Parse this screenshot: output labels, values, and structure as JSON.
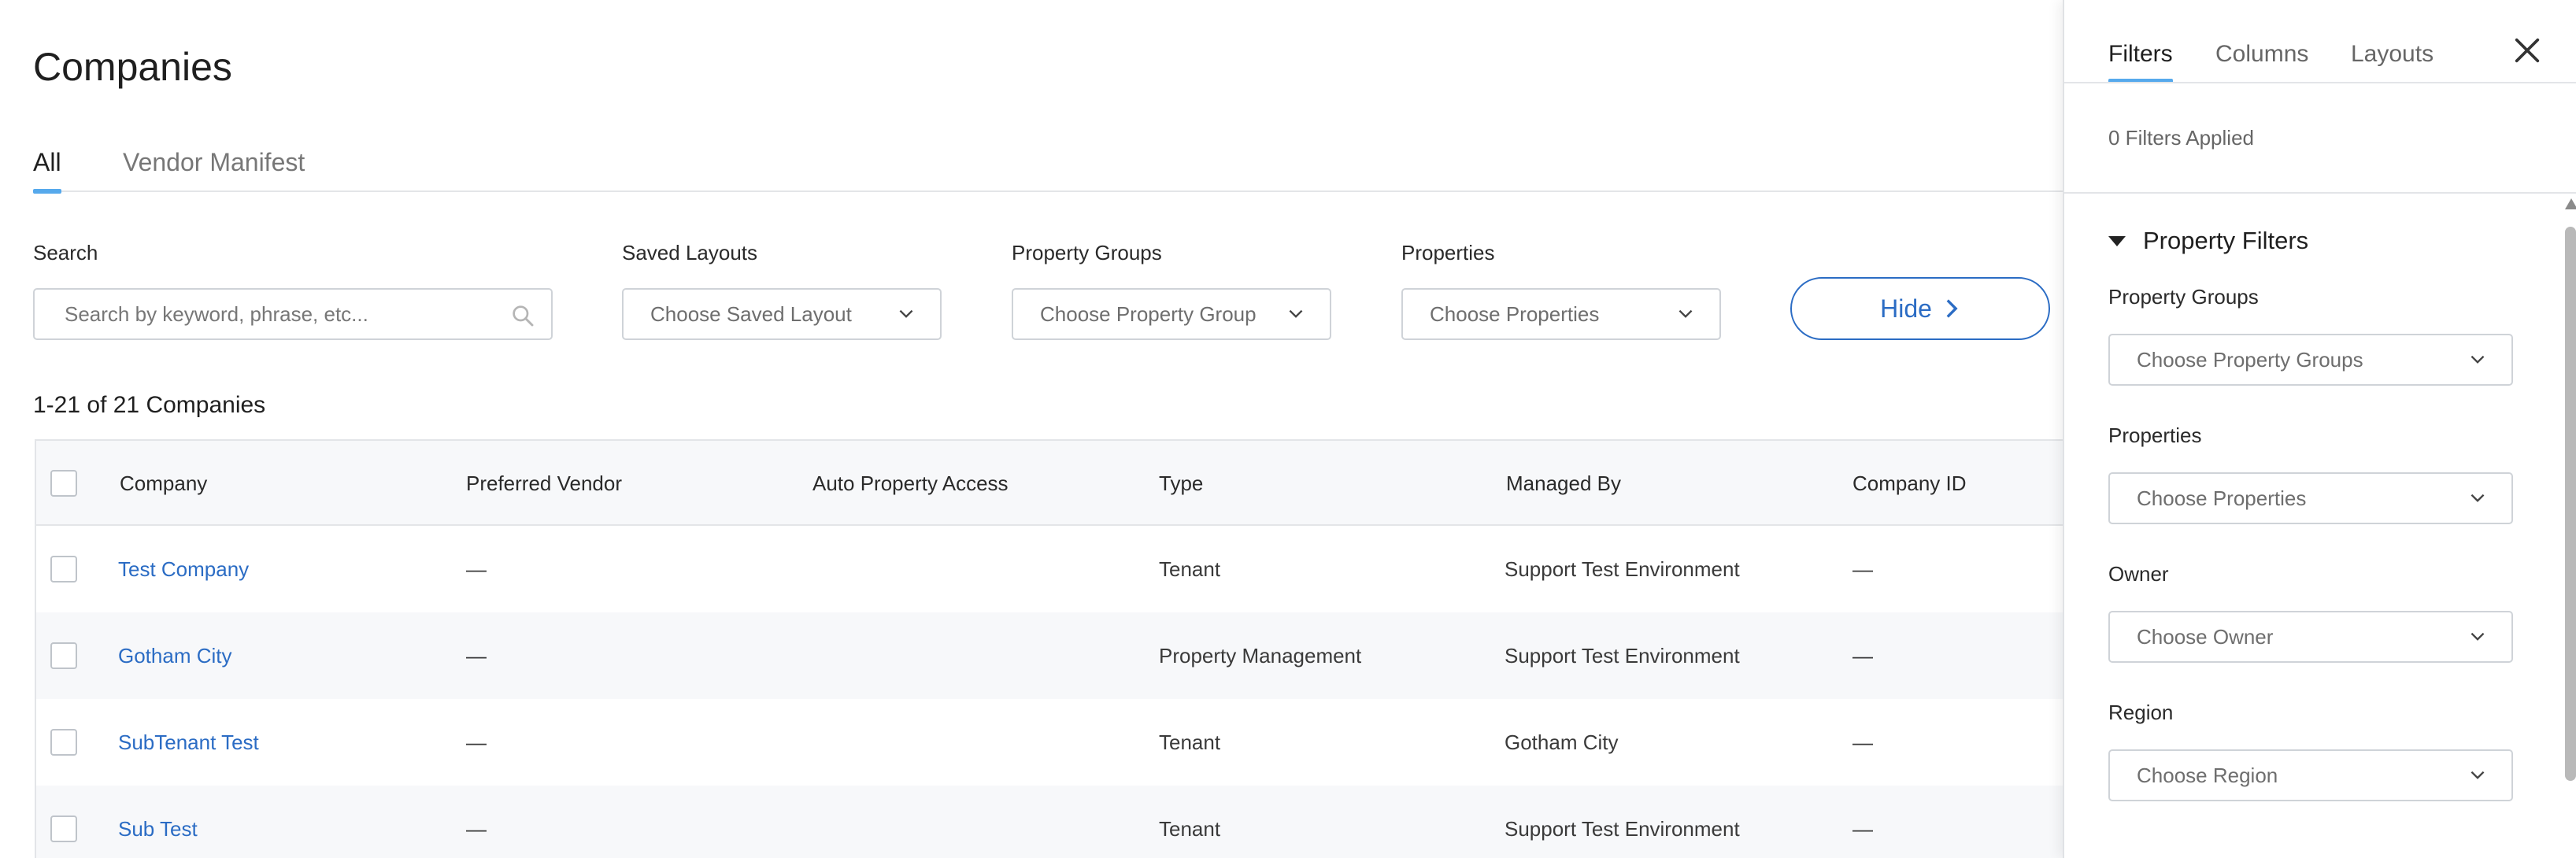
{
  "page": {
    "title": "Companies"
  },
  "tabs": [
    {
      "label": "All",
      "active": true
    },
    {
      "label": "Vendor Manifest",
      "active": false
    }
  ],
  "toolbar": {
    "search": {
      "label": "Search",
      "placeholder": "Search by keyword, phrase, etc..."
    },
    "saved_layouts": {
      "label": "Saved Layouts",
      "value": "Choose Saved Layout"
    },
    "property_groups": {
      "label": "Property Groups",
      "value": "Choose Property Group"
    },
    "properties": {
      "label": "Properties",
      "value": "Choose Properties"
    },
    "hide_label": "Hide"
  },
  "results": {
    "summary": "1-21 of 21 Companies"
  },
  "table": {
    "columns": [
      "Company",
      "Preferred Vendor",
      "Auto Property Access",
      "Type",
      "Managed By",
      "Company ID"
    ],
    "rows": [
      {
        "company": "Test Company",
        "preferred_vendor": "—",
        "auto_property_access": "",
        "type": "Tenant",
        "managed_by": "Support Test Environment",
        "company_id": "—"
      },
      {
        "company": "Gotham City",
        "preferred_vendor": "—",
        "auto_property_access": "",
        "type": "Property Management",
        "managed_by": "Support Test Environment",
        "company_id": "—"
      },
      {
        "company": "SubTenant Test",
        "preferred_vendor": "—",
        "auto_property_access": "",
        "type": "Tenant",
        "managed_by": "Gotham City",
        "company_id": "—"
      },
      {
        "company": "Sub Test",
        "preferred_vendor": "—",
        "auto_property_access": "",
        "type": "Tenant",
        "managed_by": "Support Test Environment",
        "company_id": "—"
      }
    ]
  },
  "panel": {
    "tabs": [
      {
        "label": "Filters",
        "active": true
      },
      {
        "label": "Columns",
        "active": false
      },
      {
        "label": "Layouts",
        "active": false
      }
    ],
    "applied_text": "0 Filters Applied",
    "section_title": "Property Filters",
    "filters": [
      {
        "label": "Property Groups",
        "placeholder": "Choose Property Groups"
      },
      {
        "label": "Properties",
        "placeholder": "Choose Properties"
      },
      {
        "label": "Owner",
        "placeholder": "Choose Owner"
      },
      {
        "label": "Region",
        "placeholder": "Choose Region"
      }
    ]
  },
  "colors": {
    "link": "#2b6cc4",
    "tab_indicator": "#56a9ec",
    "border": "#cfd3d8",
    "row_alt": "#f7f8fa"
  },
  "icons": [
    "search-icon",
    "chevron-down-icon",
    "chevron-right-icon",
    "close-icon",
    "caret-down-icon"
  ]
}
